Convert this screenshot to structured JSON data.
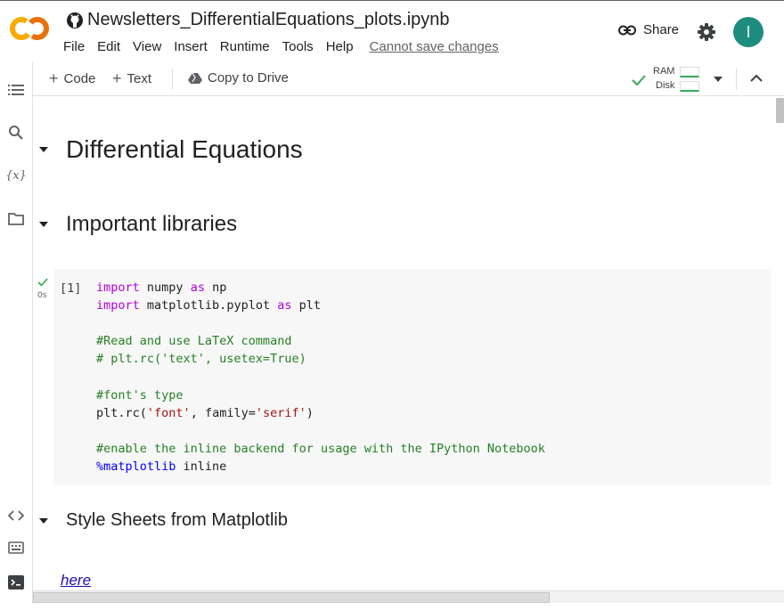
{
  "header": {
    "notebook_title": "Newsletters_DifferentialEquations_plots.ipynb",
    "menu": [
      "File",
      "Edit",
      "View",
      "Insert",
      "Runtime",
      "Tools",
      "Help"
    ],
    "save_status": "Cannot save changes",
    "share_label": "Share",
    "avatar_initial": "I",
    "avatar_color": "#1e8c7e"
  },
  "toolbar": {
    "code_label": "Code",
    "text_label": "Text",
    "copy_label": "Copy to Drive",
    "ram_label": "RAM",
    "disk_label": "Disk"
  },
  "rail": {
    "icons": [
      "table-of-contents-icon",
      "search-icon",
      "variables-icon",
      "files-icon",
      "code-snippets-icon",
      "command-palette-icon",
      "terminal-icon"
    ]
  },
  "notebook": {
    "heading_1": "Differential Equations",
    "heading_2": "Important libraries",
    "heading_3": "Style Sheets from Matplotlib",
    "cell_1": {
      "exec_count": "[1]",
      "exec_time": "0s",
      "lines": [
        "import numpy as np",
        "import matplotlib.pyplot as plt",
        "",
        "#Read and use LaTeX command",
        "# plt.rc('text', usetex=True)",
        "",
        "#font's type",
        "plt.rc('font', family='serif')",
        "",
        "#enable the inline backend for usage with the IPython Notebook",
        "%matplotlib inline"
      ]
    },
    "link_text": "here"
  },
  "colors": {
    "keyword": "#af00db",
    "comment": "#267f26",
    "string": "#a31515",
    "magic": "#0000ff",
    "link": "#1a0dab",
    "check": "#34a853"
  }
}
